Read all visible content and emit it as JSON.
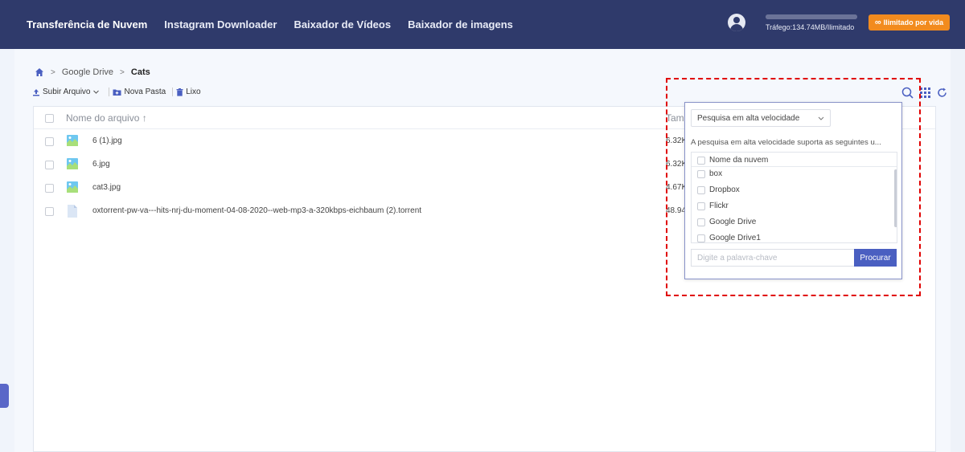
{
  "nav": {
    "items": [
      "Transferência de Nuvem",
      "Instagram Downloader",
      "Baixador de Vídeos",
      "Baixador de imagens"
    ],
    "active_index": 0
  },
  "account": {
    "traffic_text": "Tráfego:134.74MB/Ilimitado",
    "lifetime_label": "Ilimitado por vida",
    "lifetime_icon": "infinity-icon",
    "accent": "#f28b1e"
  },
  "breadcrumb": {
    "home_icon": "home-icon",
    "items": [
      "Google Drive",
      "Cats"
    ]
  },
  "toolbar": {
    "upload_label": "Subir Arquivo",
    "new_folder_label": "Nova Pasta",
    "trash_label": "Lixo"
  },
  "table": {
    "headers": {
      "name": "Nome do arquivo",
      "size": "Tama"
    },
    "rows": [
      {
        "name": "6 (1).jpg",
        "size": "6.32K",
        "icon": "image-file-icon"
      },
      {
        "name": "6.jpg",
        "size": "6.32K",
        "icon": "image-file-icon"
      },
      {
        "name": "cat3.jpg",
        "size": "4.67K",
        "icon": "image-file-icon"
      },
      {
        "name": "oxtorrent-pw-va---hits-nrj-du-moment-04-08-2020--web-mp3-a-320kbps-eichbaum (2).torrent",
        "size": "48.94",
        "icon": "generic-file-icon"
      }
    ]
  },
  "search_popup": {
    "mode_selected": "Pesquisa em alta velocidade",
    "note": "A pesquisa em alta velocidade suporta as seguintes u...",
    "list_header": "Nome da nuvem",
    "clouds": [
      "box",
      "Dropbox",
      "Flickr",
      "Google Drive",
      "Google Drive1"
    ],
    "keyword_placeholder": "Digite a palavra-chave",
    "search_label": "Procurar"
  },
  "colors": {
    "topbar": "#2f3a6b",
    "primary": "#4a5fc1",
    "highlight": "#e00000"
  }
}
